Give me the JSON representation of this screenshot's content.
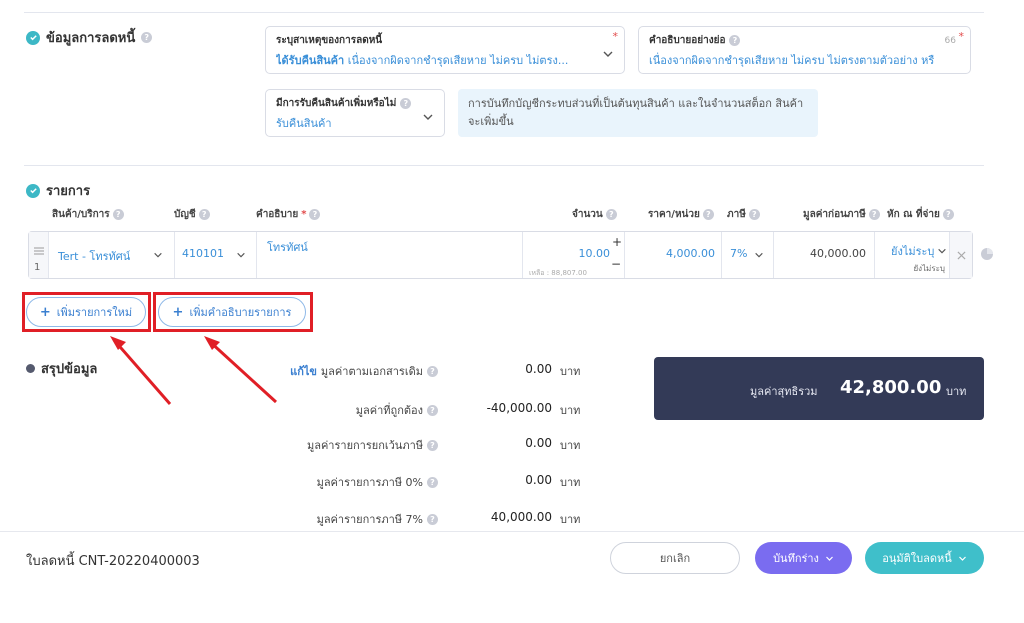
{
  "debt_info": {
    "title": "ข้อมูลการลดหนี้",
    "reason": {
      "label": "ระบุสาเหตุของการลดหนี้",
      "value_bold": "ได้รับคืนสินค้า",
      "value_rest": " เนื่องจากผิดจากชำรุดเสียหาย ไม่ครบ ไม่ตรง..."
    },
    "short_desc": {
      "label": "คำอธิบายอย่างย่อ",
      "counter": "66",
      "value": "เนื่องจากผิดจากชำรุดเสียหาย ไม่ครบ ไม่ตรงตามตัวอย่าง หรื"
    },
    "return_goods": {
      "label": "มีการรับคืนสินค้าเพิ่มหรือไม่",
      "value": "รับคืนสินค้า"
    },
    "info_note": "การบันทึกบัญชีกระทบส่วนที่เป็นต้นทุนสินค้า และในจำนวนสต็อก สินค้าจะเพิ่มขึ้น"
  },
  "items": {
    "title": "รายการ",
    "columns": {
      "product": "สินค้า/บริการ",
      "account": "บัญชี",
      "description": "คำอธิบาย",
      "quantity": "จำนวน",
      "unit_price": "ราคา/หน่วย",
      "tax": "ภาษี",
      "pretax": "มูลค่าก่อนภาษี",
      "withholding": "หัก ณ ที่จ่าย"
    },
    "row": {
      "index": "1",
      "product": "Tert - โทรทัศน์",
      "account": "410101",
      "description": "โทรทัศน์",
      "quantity": "10.00",
      "remaining": "เหลือ : 88,807.00",
      "unit_price": "4,000.00",
      "tax": "7%",
      "pretax": "40,000.00",
      "withholding": "ยังไม่ระบุ",
      "withholding_sub": "ยังไม่ระบุ"
    },
    "add_item": "เพิ่มรายการใหม่",
    "add_desc": "เพิ่มคำอธิบายรายการ"
  },
  "summary": {
    "title": "สรุปข้อมูล",
    "edit": "แก้ไข",
    "lines": [
      {
        "label": "มูลค่าตามเอกสารเดิม",
        "value": "0.00",
        "unit": "บาท"
      },
      {
        "label": "มูลค่าที่ถูกต้อง",
        "value": "-40,000.00",
        "unit": "บาท"
      },
      {
        "label": "มูลค่ารายการยกเว้นภาษี",
        "value": "0.00",
        "unit": "บาท"
      },
      {
        "label": "มูลค่ารายการภาษี 0%",
        "value": "0.00",
        "unit": "บาท"
      },
      {
        "label": "มูลค่ารายการภาษี 7%",
        "value": "40,000.00",
        "unit": "บาท"
      }
    ],
    "net_label": "มูลค่าสุทธิรวม",
    "net_value": "42,800.00",
    "net_unit": "บาท"
  },
  "footer": {
    "doc_title": "ใบลดหนี้ CNT-20220400003",
    "cancel": "ยกเลิก",
    "save_draft": "บันทึกร่าง",
    "approve": "อนุมัติใบลดหนี้"
  },
  "colors": {
    "accent": "#3db8c6",
    "link": "#3a8fd8",
    "purple": "#7a6cf0",
    "teal": "#3fbfca",
    "dark": "#333a57",
    "annotation": "#e01f26"
  }
}
